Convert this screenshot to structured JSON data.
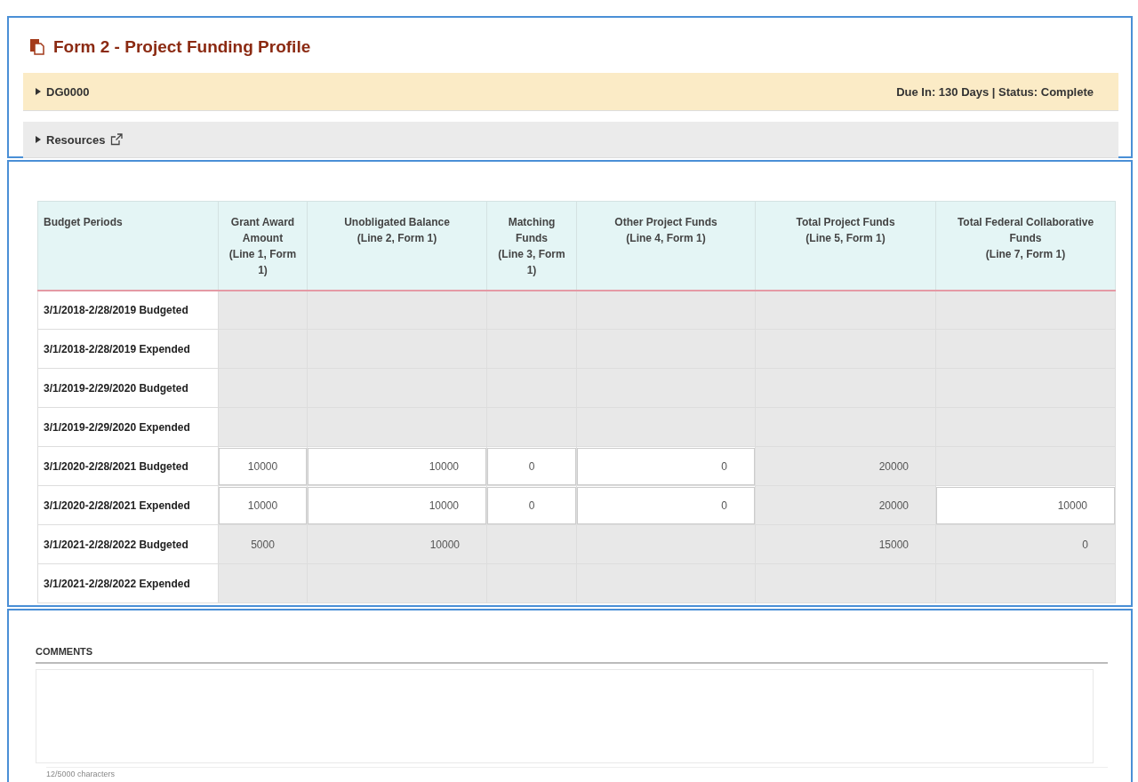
{
  "form": {
    "title": "Form 2 - Project Funding Profile"
  },
  "grant_bar": {
    "id": "DG0000",
    "expanded": false,
    "summary": "Due In: 130 Days | Status: Complete"
  },
  "resources": {
    "label": "Resources",
    "expanded": false
  },
  "table": {
    "columns": [
      "Budget Periods",
      "Grant Award\nAmount\n(Line 1, Form\n1)",
      "Unobligated Balance\n(Line 2, Form 1)",
      "Matching\nFunds\n(Line 3, Form\n1)",
      "Other Project Funds\n(Line 4, Form 1)",
      "Total Project Funds\n(Line 5, Form 1)",
      "Total Federal Collaborative\nFunds\n(Line 7, Form 1)"
    ],
    "rows": [
      {
        "cells": [
          {
            "kind": "period",
            "value": "3/1/2018-2/28/2019 Budgeted"
          },
          {
            "kind": "amount",
            "editable": false
          },
          {
            "kind": "amount",
            "editable": false
          },
          {
            "kind": "amount",
            "editable": false
          },
          {
            "kind": "amount",
            "editable": false
          },
          {
            "kind": "amount",
            "editable": false
          },
          {
            "kind": "amount",
            "editable": false
          }
        ]
      },
      {
        "cells": [
          {
            "kind": "period",
            "value": "3/1/2018-2/28/2019 Expended"
          },
          {
            "kind": "amount",
            "editable": false
          },
          {
            "kind": "amount",
            "editable": false
          },
          {
            "kind": "amount",
            "editable": false
          },
          {
            "kind": "amount",
            "editable": false
          },
          {
            "kind": "amount",
            "editable": false
          },
          {
            "kind": "amount",
            "editable": false
          }
        ]
      },
      {
        "cells": [
          {
            "kind": "period",
            "value": "3/1/2019-2/29/2020 Budgeted"
          },
          {
            "kind": "amount",
            "editable": false
          },
          {
            "kind": "amount",
            "editable": false
          },
          {
            "kind": "amount",
            "editable": false
          },
          {
            "kind": "amount",
            "editable": false
          },
          {
            "kind": "amount",
            "editable": false
          },
          {
            "kind": "amount",
            "editable": false
          }
        ]
      },
      {
        "cells": [
          {
            "kind": "period",
            "value": "3/1/2019-2/29/2020 Expended"
          },
          {
            "kind": "amount",
            "editable": false
          },
          {
            "kind": "amount",
            "editable": false
          },
          {
            "kind": "amount",
            "editable": false
          },
          {
            "kind": "amount",
            "editable": false
          },
          {
            "kind": "amount",
            "editable": false
          },
          {
            "kind": "amount",
            "editable": false
          }
        ]
      },
      {
        "cells": [
          {
            "kind": "period",
            "value": "3/1/2020-2/28/2021 Budgeted"
          },
          {
            "kind": "amount",
            "editable": true,
            "value": "10000"
          },
          {
            "kind": "amount",
            "editable": true,
            "value": "10000"
          },
          {
            "kind": "amount",
            "editable": true,
            "value": "0"
          },
          {
            "kind": "amount",
            "editable": true,
            "value": "0"
          },
          {
            "kind": "amount",
            "editable": false,
            "value": "20000"
          },
          {
            "kind": "amount",
            "editable": false
          }
        ]
      },
      {
        "cells": [
          {
            "kind": "period",
            "value": "3/1/2020-2/28/2021 Expended"
          },
          {
            "kind": "amount",
            "editable": true,
            "value": "10000"
          },
          {
            "kind": "amount",
            "editable": true,
            "value": "10000"
          },
          {
            "kind": "amount",
            "editable": true,
            "value": "0"
          },
          {
            "kind": "amount",
            "editable": true,
            "value": "0"
          },
          {
            "kind": "amount",
            "editable": false,
            "value": "20000"
          },
          {
            "kind": "amount",
            "editable": true,
            "value": "10000"
          }
        ]
      },
      {
        "cells": [
          {
            "kind": "period",
            "value": "3/1/2021-2/28/2022 Budgeted"
          },
          {
            "kind": "amount",
            "editable": false,
            "value": "5000"
          },
          {
            "kind": "amount",
            "editable": false,
            "value": "10000"
          },
          {
            "kind": "amount",
            "editable": false
          },
          {
            "kind": "amount",
            "editable": false
          },
          {
            "kind": "amount",
            "editable": false,
            "value": "15000"
          },
          {
            "kind": "amount",
            "editable": false,
            "value": "0"
          }
        ]
      },
      {
        "cells": [
          {
            "kind": "period",
            "value": "3/1/2021-2/28/2022 Expended"
          },
          {
            "kind": "amount",
            "editable": false
          },
          {
            "kind": "amount",
            "editable": false
          },
          {
            "kind": "amount",
            "editable": false
          },
          {
            "kind": "amount",
            "editable": false
          },
          {
            "kind": "amount",
            "editable": false
          },
          {
            "kind": "amount",
            "editable": false
          }
        ]
      }
    ]
  },
  "comments": {
    "label": "COMMENTS",
    "counter": "12/5000 characters"
  }
}
